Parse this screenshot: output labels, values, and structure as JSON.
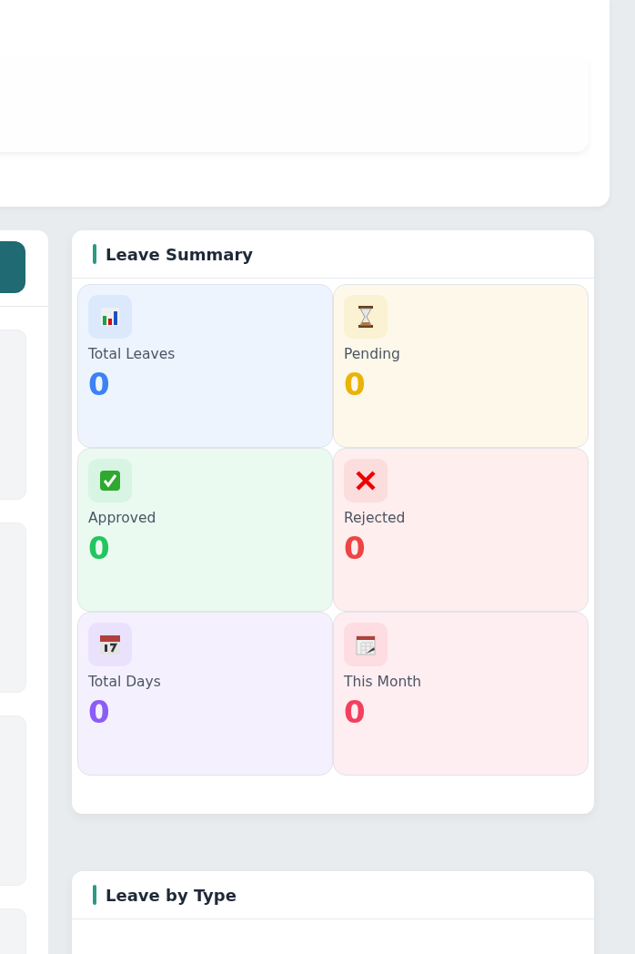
{
  "leave_summary": {
    "title": "Leave Summary",
    "stats": [
      {
        "kind": "chart",
        "label": "Total Leaves",
        "value": "0",
        "color": "#3b82f6"
      },
      {
        "kind": "hourglass",
        "label": "Pending",
        "value": "0",
        "color": "#eab308"
      },
      {
        "kind": "check",
        "label": "Approved",
        "value": "0",
        "color": "#22c55e"
      },
      {
        "kind": "cross",
        "label": "Rejected",
        "value": "0",
        "color": "#ef4444"
      },
      {
        "kind": "calendar",
        "label": "Total Days",
        "value": "0",
        "color": "#8b5cf6"
      },
      {
        "kind": "notepad",
        "label": "This Month",
        "value": "0",
        "color": "#f43f5e"
      }
    ]
  },
  "leave_by_type": {
    "title": "Leave by Type"
  }
}
